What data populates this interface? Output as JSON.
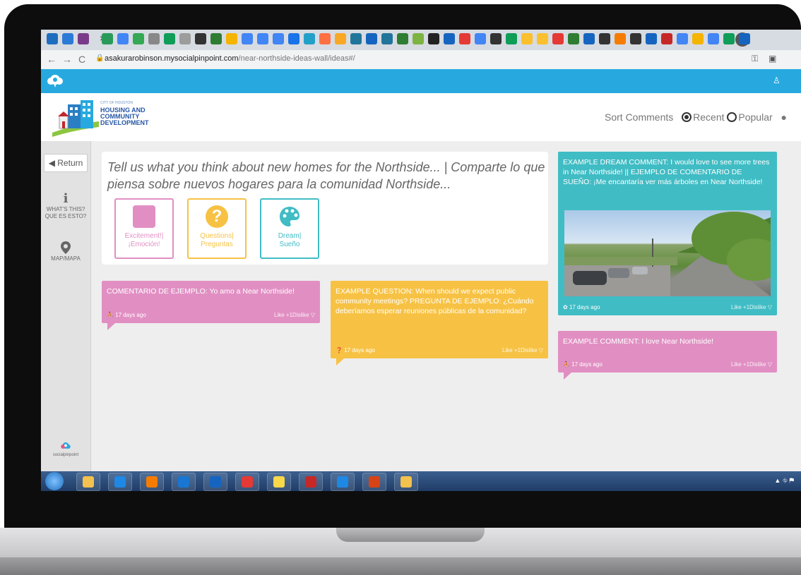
{
  "browser": {
    "tab_close_glyph": "×",
    "new_tab_glyph": "+",
    "url_host": "asakurarobinson.mysocialpinpoint.com",
    "url_path": "/near-northside-ideas-wall/ideas#/",
    "tab_icons": [
      "#1f6ebd",
      "#2b7bd6",
      "#7a3a8a",
      "#2a9a5a",
      "#4285f4",
      "#34a853",
      "#888888",
      "#0f9d58",
      "#9c9c9c",
      "#333333",
      "#2e7d32",
      "#f4b400",
      "#4285f4",
      "#4285f4",
      "#4285f4",
      "#1a73e8",
      "#23a0c8",
      "#ff7043",
      "#f9a825",
      "#21759b",
      "#1565c0",
      "#21759b",
      "#2e7d32",
      "#7cb342",
      "#222222",
      "#1565c0",
      "#e53935",
      "#4285f4",
      "#333333",
      "#0f9d58",
      "#fbc02d",
      "#fbc02d",
      "#e53935",
      "#2e7d32",
      "#1565c0",
      "#333333",
      "#f57c00",
      "#333333",
      "#1565c0",
      "#c62828",
      "#4285f4",
      "#f4b400",
      "#4285f4",
      "#0f9d58",
      "#1565c0"
    ]
  },
  "header": {
    "org_small": "CITY OF HOUSTON",
    "org_line1": "HOUSING AND",
    "org_line2": "COMMUNITY",
    "org_line3": "DEVELOPMENT",
    "sort_label": "Sort Comments",
    "sort_recent": "Recent",
    "sort_popular": "Popular"
  },
  "sidebar": {
    "return_label": "Return",
    "whats_this_line1": "WHAT'S THIS?",
    "whats_this_line2": "QUE ES ESTO?",
    "map_label": "MAP/MAPA",
    "powered_by": "socialpinpoint"
  },
  "prompt": {
    "text": "Tell us what you think about new homes for the Northside... | Comparte lo que piensa sobre nuevos hogares para la comunidad Northside...",
    "categories": [
      {
        "line1": "Excitement!|",
        "line2": "¡Emoción!",
        "color": "#e18fc3"
      },
      {
        "line1": "Questions|",
        "line2": "Preguntas",
        "color": "#f7c244"
      },
      {
        "line1": "Dream|",
        "line2": "Sueño",
        "color": "#40bcc4"
      }
    ]
  },
  "comments": [
    {
      "text": "COMENTARIO DE EJEMPLO: Yo amo a Near Northside!",
      "age": "17 days ago",
      "likes": "Like +1Dislike",
      "color": "#e18fc3"
    },
    {
      "text": "EXAMPLE QUESTION: When should we expect public community meetings? PREGUNTA DE EJEMPLO: ¿Cuándo deberíamos esperar reuniones públicas de la comunidad?",
      "age": "17 days ago",
      "likes": "Like +1Dislike",
      "color": "#f7c244"
    },
    {
      "text": "EXAMPLE DREAM COMMENT: I would love to see more trees in Near Northside! || EJEMPLO DE COMENTARIO DE SUEÑO: ¡Me encantaría ver más árboles en Near Northside!",
      "age": "17 days ago",
      "likes": "Like +1Dislike",
      "color": "#40bcc4"
    },
    {
      "text": "EXAMPLE COMMENT: I love Near Northside!",
      "age": "17 days ago",
      "likes": "Like +1Dislike",
      "color": "#e18fc3"
    }
  ],
  "taskbar": {
    "apps": [
      "file-explorer",
      "internet-explorer",
      "media-player",
      "edge",
      "outlook",
      "chrome",
      "sticky-notes",
      "acrobat",
      "onedrive",
      "powerpoint",
      "calculator"
    ]
  }
}
